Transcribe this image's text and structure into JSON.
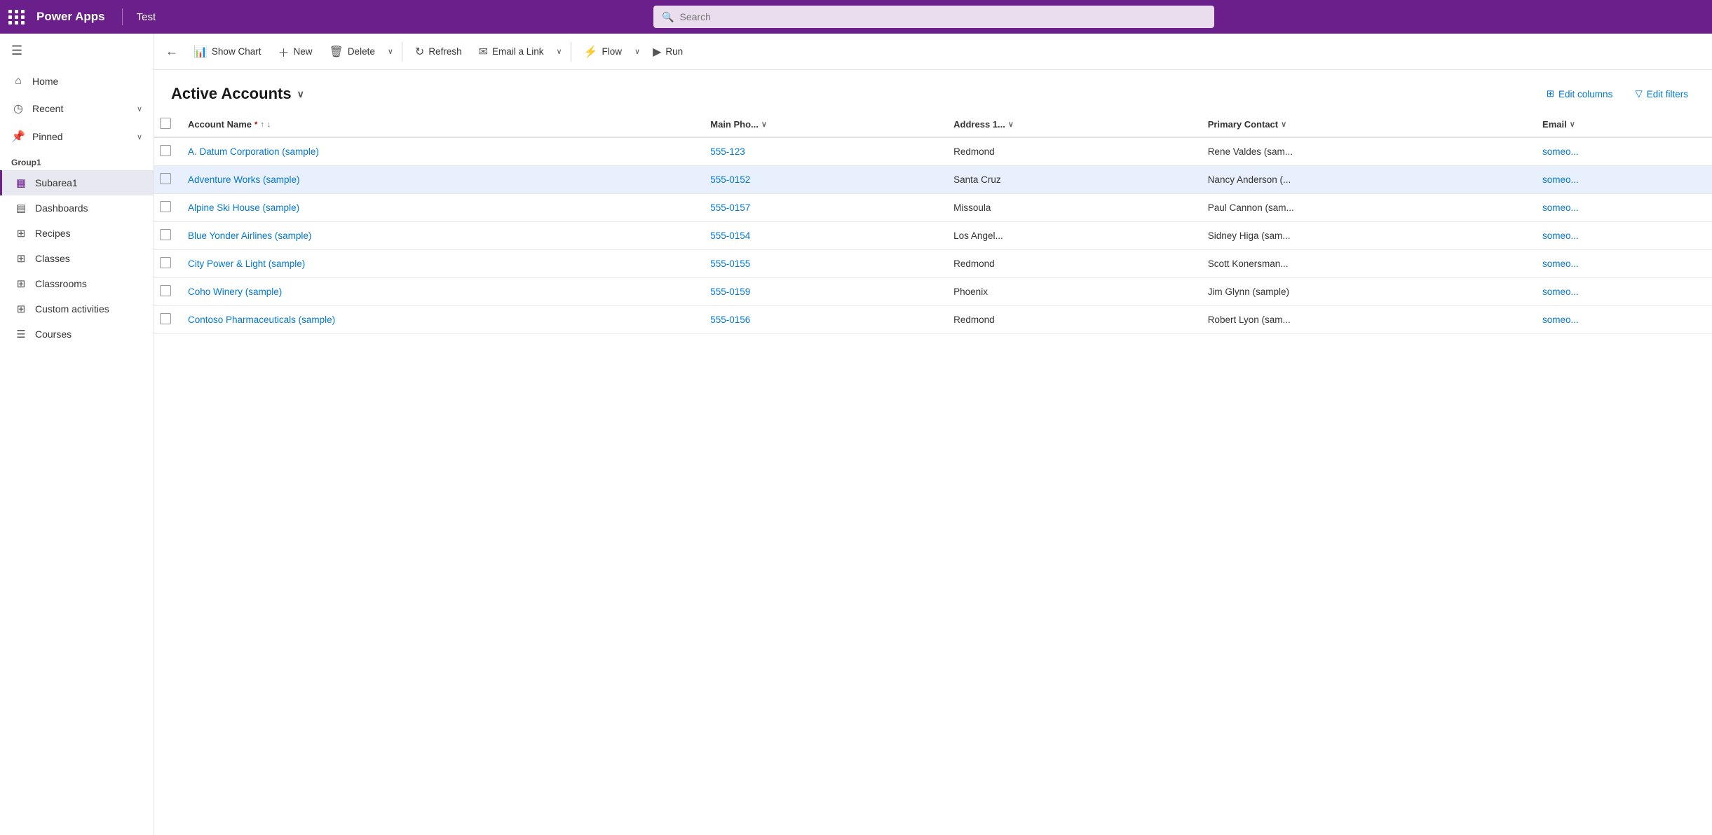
{
  "topBar": {
    "logoText": "Power Apps",
    "appName": "Test",
    "searchPlaceholder": "Search"
  },
  "toolbar": {
    "backLabel": "←",
    "showChartLabel": "Show Chart",
    "newLabel": "New",
    "deleteLabel": "Delete",
    "refreshLabel": "Refresh",
    "emailLinkLabel": "Email a Link",
    "flowLabel": "Flow",
    "runLabel": "Run"
  },
  "viewHeader": {
    "title": "Active Accounts",
    "editColumnsLabel": "Edit columns",
    "editFiltersLabel": "Edit filters"
  },
  "table": {
    "columns": [
      {
        "key": "accountName",
        "label": "Account Name",
        "required": true,
        "sortable": true
      },
      {
        "key": "mainPhone",
        "label": "Main Pho...",
        "sortable": true
      },
      {
        "key": "address1",
        "label": "Address 1...",
        "sortable": true
      },
      {
        "key": "primaryContact",
        "label": "Primary Contact",
        "sortable": true
      },
      {
        "key": "email",
        "label": "Email",
        "sortable": true
      }
    ],
    "rows": [
      {
        "accountName": "A. Datum Corporation (sample)",
        "mainPhone": "555-123",
        "address1": "Redmond",
        "primaryContact": "Rene Valdes (sam...",
        "email": "someo..."
      },
      {
        "accountName": "Adventure Works (sample)",
        "mainPhone": "555-0152",
        "address1": "Santa Cruz",
        "primaryContact": "Nancy Anderson (...",
        "email": "someo..."
      },
      {
        "accountName": "Alpine Ski House (sample)",
        "mainPhone": "555-0157",
        "address1": "Missoula",
        "primaryContact": "Paul Cannon (sam...",
        "email": "someo..."
      },
      {
        "accountName": "Blue Yonder Airlines (sample)",
        "mainPhone": "555-0154",
        "address1": "Los Angel...",
        "primaryContact": "Sidney Higa (sam...",
        "email": "someo..."
      },
      {
        "accountName": "City Power & Light (sample)",
        "mainPhone": "555-0155",
        "address1": "Redmond",
        "primaryContact": "Scott Konersman...",
        "email": "someo..."
      },
      {
        "accountName": "Coho Winery (sample)",
        "mainPhone": "555-0159",
        "address1": "Phoenix",
        "primaryContact": "Jim Glynn (sample)",
        "email": "someo..."
      },
      {
        "accountName": "Contoso Pharmaceuticals (sample)",
        "mainPhone": "555-0156",
        "address1": "Redmond",
        "primaryContact": "Robert Lyon (sam...",
        "email": "someo..."
      }
    ]
  },
  "sidebar": {
    "navItems": [
      {
        "icon": "⌂",
        "label": "Home",
        "hasChevron": false
      },
      {
        "icon": "◷",
        "label": "Recent",
        "hasChevron": true
      },
      {
        "icon": "📌",
        "label": "Pinned",
        "hasChevron": true
      }
    ],
    "groupTitle": "Group1",
    "subItems": [
      {
        "icon": "▦",
        "label": "Subarea1",
        "active": true
      },
      {
        "icon": "▤",
        "label": "Dashboards",
        "active": false
      },
      {
        "icon": "⊞",
        "label": "Recipes",
        "active": false
      },
      {
        "icon": "⊞",
        "label": "Classes",
        "active": false
      },
      {
        "icon": "⊞",
        "label": "Classrooms",
        "active": false
      },
      {
        "icon": "⊞",
        "label": "Custom activities",
        "active": false
      },
      {
        "icon": "☰",
        "label": "Courses",
        "active": false
      }
    ]
  }
}
